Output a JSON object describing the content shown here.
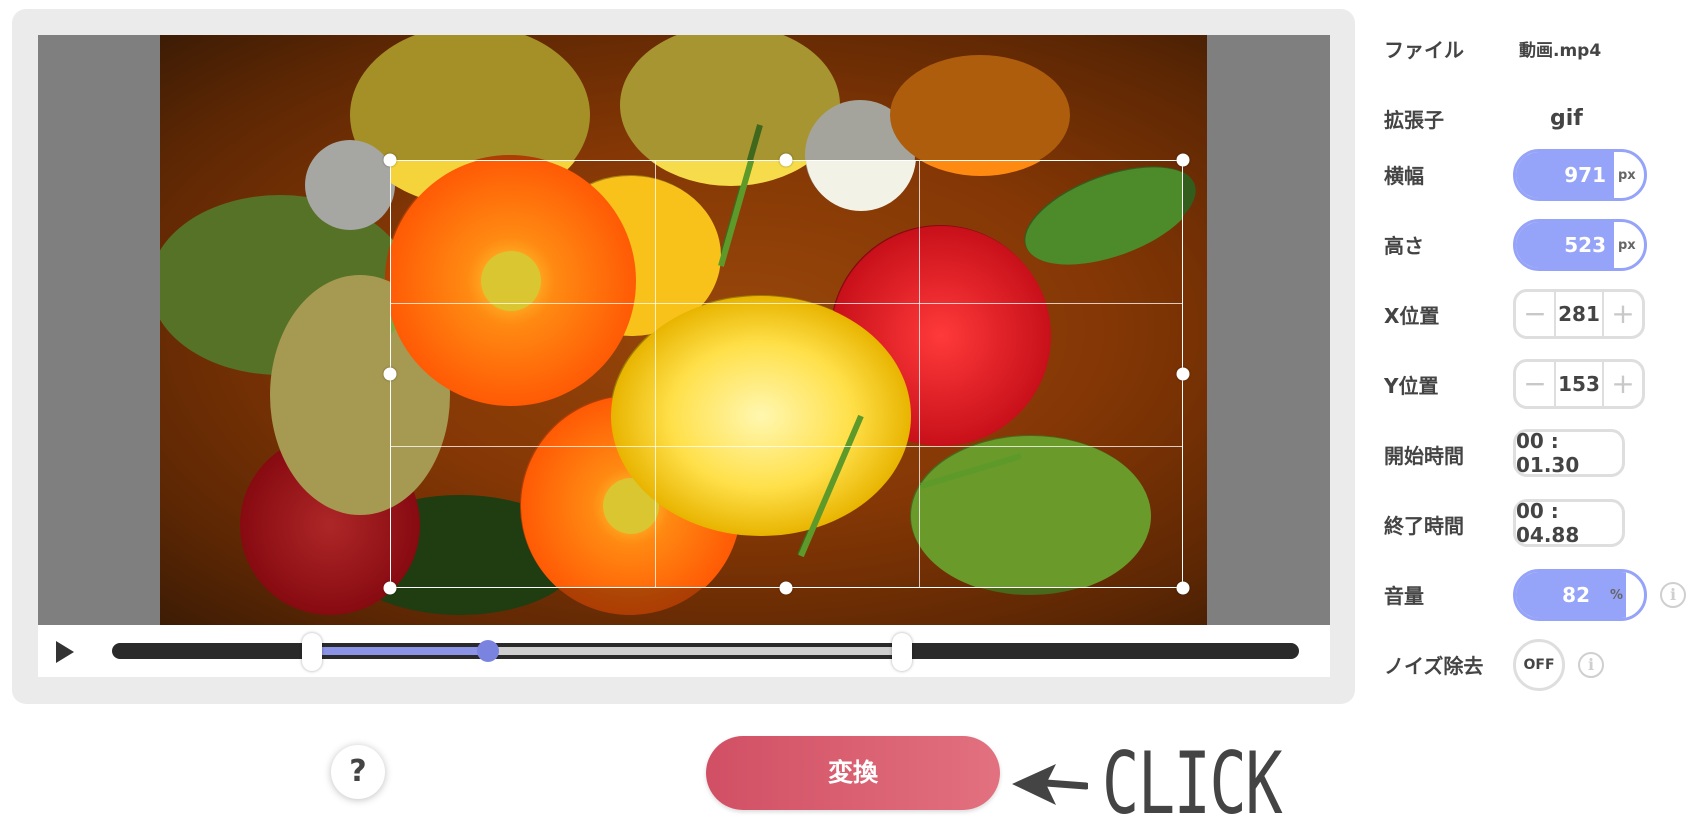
{
  "settings": {
    "file": {
      "label": "ファイル",
      "value": "動画.mp4"
    },
    "extension": {
      "label": "拡張子",
      "value": "gif"
    },
    "width": {
      "label": "横幅",
      "value": "971",
      "unit": "px"
    },
    "height": {
      "label": "高さ",
      "value": "523",
      "unit": "px"
    },
    "x_position": {
      "label": "X位置",
      "value": "281",
      "minus": "−",
      "plus": "+"
    },
    "y_position": {
      "label": "Y位置",
      "value": "153",
      "minus": "−",
      "plus": "+"
    },
    "start_time": {
      "label": "開始時間",
      "value": "00 : 01.30"
    },
    "end_time": {
      "label": "終了時間",
      "value": "00 : 04.88"
    },
    "volume": {
      "label": "音量",
      "value": "82",
      "unit": "%"
    },
    "noise_removal": {
      "label": "ノイズ除去",
      "state": "OFF"
    }
  },
  "info_glyph": "i",
  "timeline": {
    "playhead_position_fraction": 0.31
  },
  "bottom": {
    "help_label": "?",
    "convert_label": "変換",
    "click_annotation": "CLICK"
  },
  "colors": {
    "accent_blue": "#95a3f9",
    "convert_red": "#d14f64",
    "progress": "#8b93e6"
  }
}
